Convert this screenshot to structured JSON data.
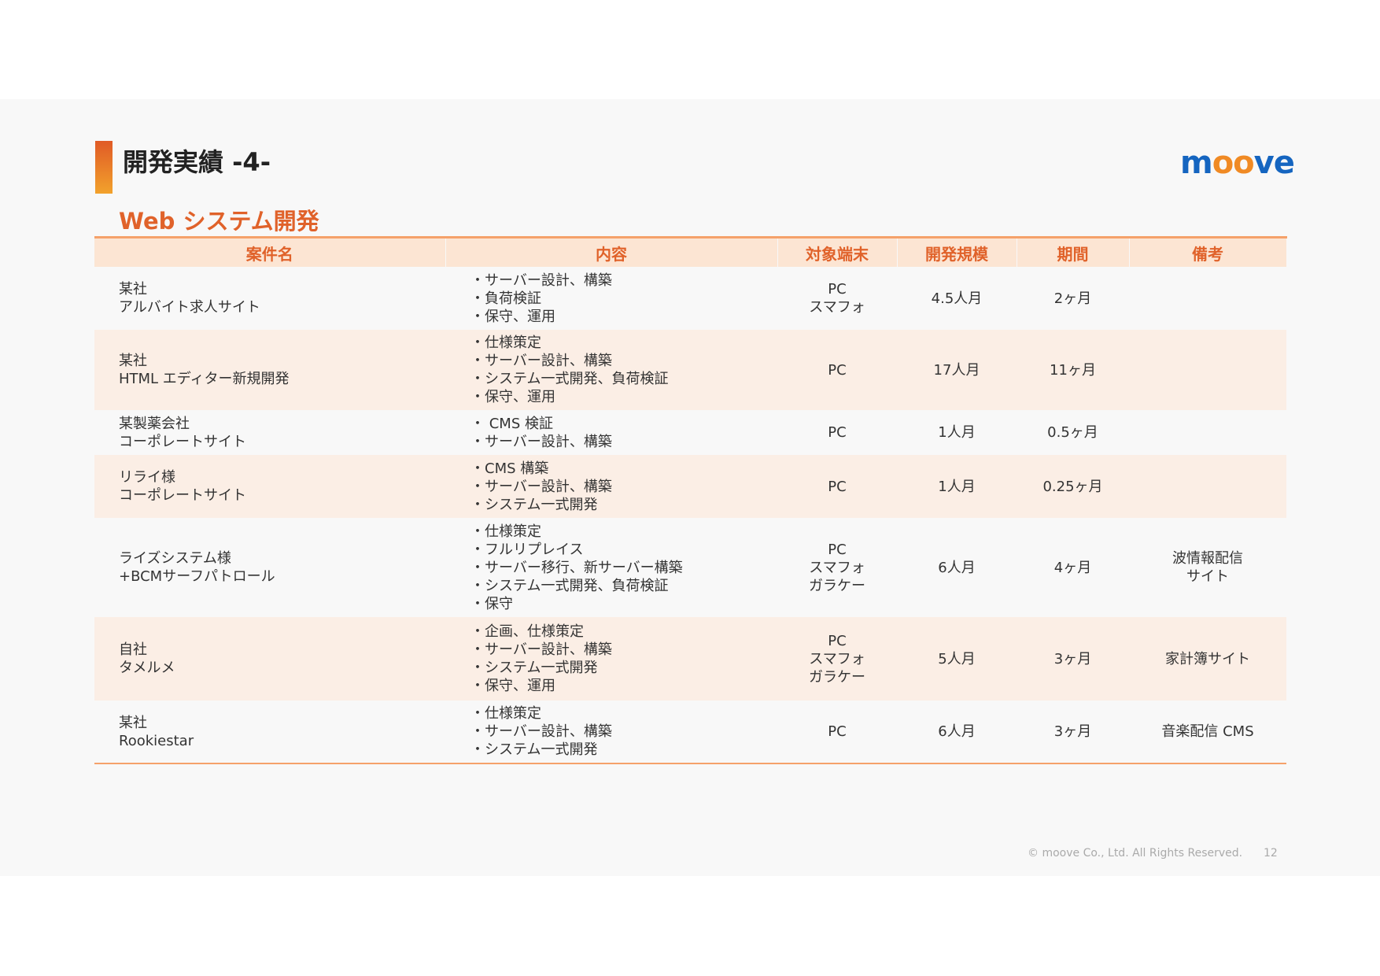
{
  "header": {
    "title": "開発実績 -4-",
    "logo_pre": "m",
    "logo_oo": "oo",
    "logo_post": "ve"
  },
  "section": {
    "subtitle": "Web システム開発"
  },
  "table": {
    "columns": [
      "案件名",
      "内容",
      "対象端末",
      "開発規模",
      "期間",
      "備考"
    ],
    "rows": [
      {
        "name": [
          "某社",
          "アルバイト求人サイト"
        ],
        "content": [
          "・サーバー設計、構築",
          "・負荷検証",
          "・保守、運用"
        ],
        "device": [
          "PC",
          "スマフォ"
        ],
        "scale": "4.5人月",
        "period": "2ヶ月",
        "note": []
      },
      {
        "name": [
          "某社",
          "HTML エディター新規開発"
        ],
        "content": [
          "・仕様策定",
          "・サーバー設計、構築",
          "・システム一式開発、負荷検証",
          "・保守、運用"
        ],
        "device": [
          "PC"
        ],
        "scale": "17人月",
        "period": "11ヶ月",
        "note": []
      },
      {
        "name": [
          "某製薬会社",
          "コーポレートサイト"
        ],
        "content": [
          "・ CMS 検証",
          "・サーバー設計、構築"
        ],
        "device": [
          "PC"
        ],
        "scale": "1人月",
        "period": "0.5ヶ月",
        "note": []
      },
      {
        "name": [
          "リライ様",
          "コーポレートサイト"
        ],
        "content": [
          "・CMS 構築",
          "・サーバー設計、構築",
          "・システム一式開発"
        ],
        "device": [
          "PC"
        ],
        "scale": "1人月",
        "period": "0.25ヶ月",
        "note": []
      },
      {
        "name": [
          "ライズシステム様",
          "+BCMサーフパトロール"
        ],
        "content": [
          "・仕様策定",
          "・フルリプレイス",
          "・サーバー移行、新サーバー構築",
          "・システム一式開発、負荷検証",
          "・保守"
        ],
        "device": [
          "PC",
          "スマフォ",
          "ガラケー"
        ],
        "scale": "6人月",
        "period": "4ヶ月",
        "note": [
          "波情報配信",
          "サイト"
        ]
      },
      {
        "name": [
          "自社",
          "タメルメ"
        ],
        "content": [
          "・企画、仕様策定",
          "・サーバー設計、構築",
          "・システム一式開発",
          "・保守、運用"
        ],
        "device": [
          "PC",
          "スマフォ",
          "ガラケー"
        ],
        "scale": "5人月",
        "period": "3ヶ月",
        "note": [
          "家計簿サイト"
        ]
      },
      {
        "name": [
          "某社",
          "Rookiestar"
        ],
        "content": [
          "・仕様策定",
          "・サーバー設計、構築",
          "・システム一式開発"
        ],
        "device": [
          "PC"
        ],
        "scale": "6人月",
        "period": "3ヶ月",
        "note": [
          "音楽配信 CMS"
        ]
      }
    ]
  },
  "footer": {
    "copyright": "© moove Co., Ltd. All Rights Reserved.",
    "page": "12"
  },
  "colors": {
    "accent": "#e0622a",
    "header_bg": "#fce5d3",
    "logo_blue": "#1565c0",
    "logo_orange": "#f08a24"
  }
}
